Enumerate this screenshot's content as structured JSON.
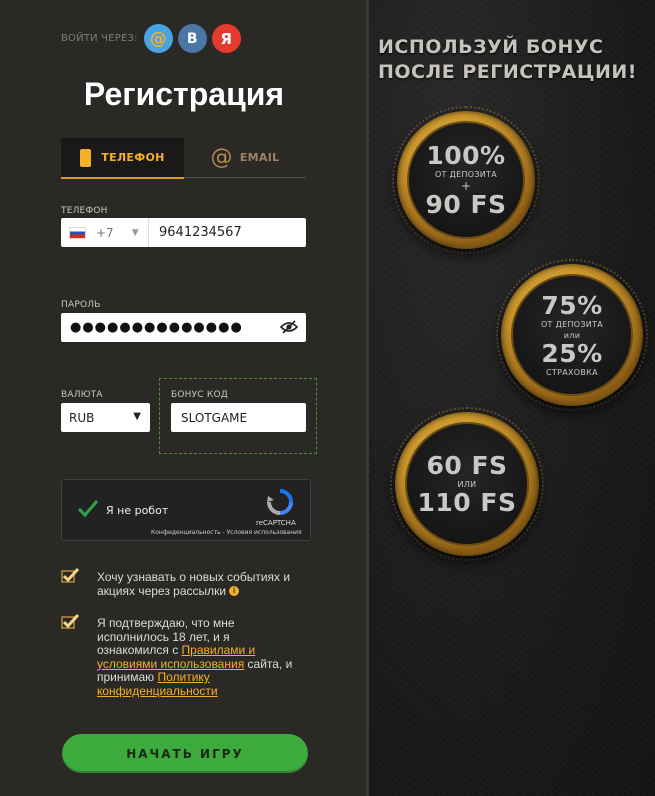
{
  "login_via": {
    "label": "ВОЙТИ ЧЕРЕЗ:",
    "providers": [
      "@",
      "B",
      "Я"
    ]
  },
  "title": "Регистрация",
  "tabs": {
    "phone": "ТЕЛЕФОН",
    "email": "EMAIL"
  },
  "phone": {
    "label": "ТЕЛЕФОН",
    "country_code": "+7",
    "value": "9641234567"
  },
  "password": {
    "label": "ПАРОЛЬ",
    "value": "●●●●●●●●●●●●●●"
  },
  "currency": {
    "label": "ВАЛЮТА",
    "value": "RUB"
  },
  "bonus": {
    "label": "БОНУС КОД",
    "value": "SLOTGAME"
  },
  "captcha": {
    "text": "Я не робот",
    "brand": "reCAPTCHA",
    "links": "Конфиденциальность - Условия использования"
  },
  "consent1": {
    "text": "Хочу узнавать о новых событиях и акциях через рассылки"
  },
  "consent2": {
    "text_before": "Я подтверждаю, что мне исполнилось 18 лет, и я ознакомился с ",
    "link1": "Правилами и условиями использования",
    "text_middle": " сайта, и принимаю ",
    "link2": "Политику конфиденциальности"
  },
  "start_button": "НАЧАТЬ ИГРУ",
  "promo": {
    "headline_line1": "ИСПОЛЬЗУЙ БОНУС",
    "headline_line2": "ПОСЛЕ РЕГИСТРАЦИИ!",
    "coin1": {
      "big1": "100%",
      "small1": "ОТ ДЕПОЗИТА",
      "plus": "+",
      "big2": "90 FS"
    },
    "coin2": {
      "big1": "75%",
      "small1": "ОТ ДЕПОЗИТА",
      "small2": "или",
      "big2": "25%",
      "small3": "СТРАХОВКА"
    },
    "coin3": {
      "big1": "60 FS",
      "small1": "ИЛИ",
      "big2": "110 FS"
    }
  },
  "colors": {
    "accent": "#f5b02a",
    "button": "#3daa3d",
    "panel": "#2b2925"
  }
}
